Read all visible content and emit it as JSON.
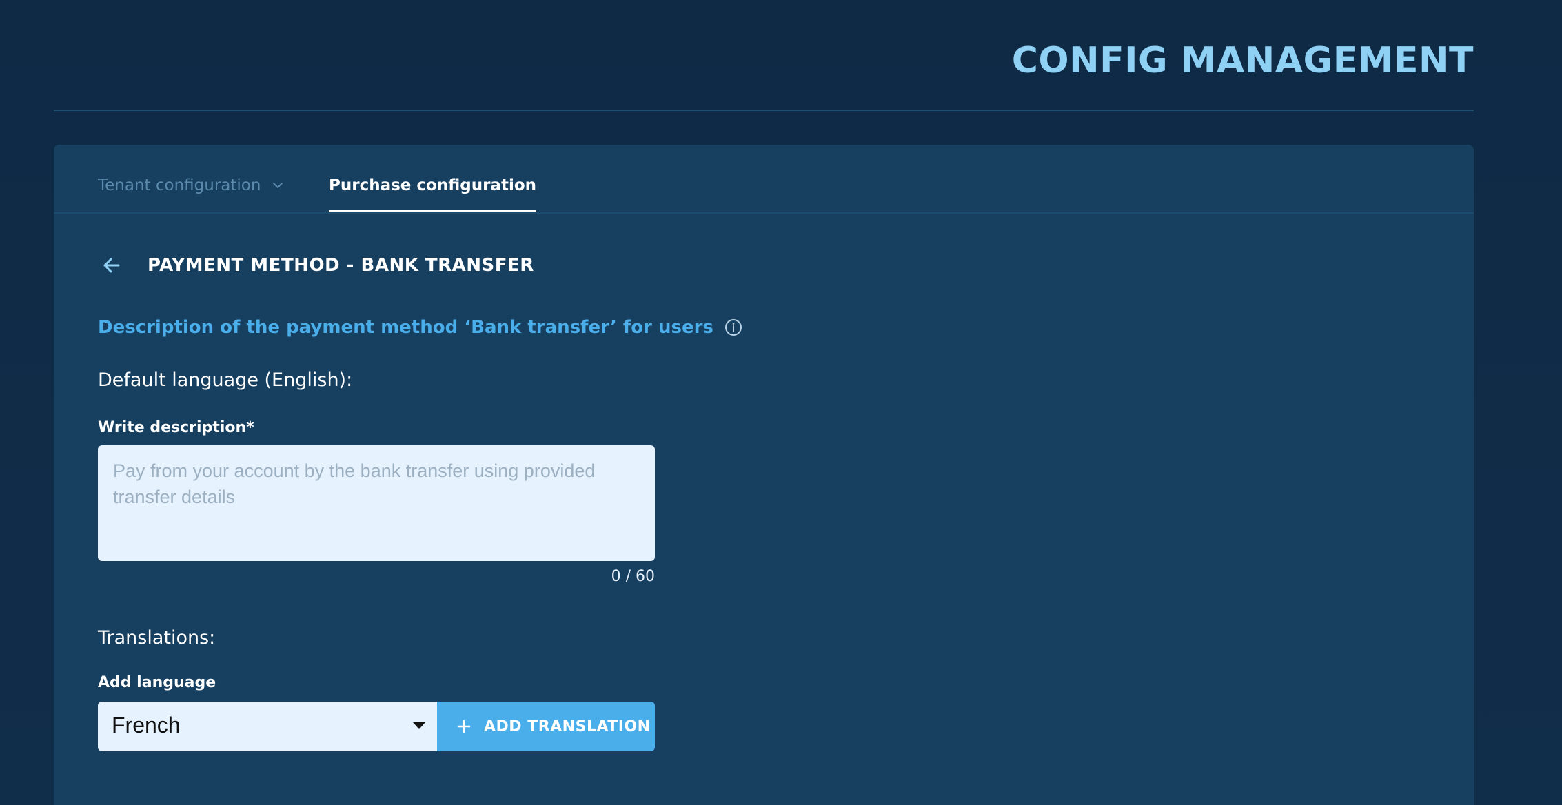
{
  "header": {
    "title": "CONFIG MANAGEMENT"
  },
  "tabs": [
    {
      "label": "Tenant configuration",
      "active": false,
      "icon": "chevron-down-icon"
    },
    {
      "label": "Purchase configuration",
      "active": true
    }
  ],
  "section": {
    "back_icon": "arrow-left-icon",
    "title": "PAYMENT METHOD - BANK TRANSFER"
  },
  "description": {
    "heading": "Description of the payment method ‘Bank transfer’ for users",
    "info_icon": "info-icon",
    "default_language_label": "Default language (English):",
    "field_label": "Write description*",
    "value": "",
    "placeholder": "Pay from your account by the bank transfer using provided transfer details",
    "counter": "0 / 60"
  },
  "translations": {
    "label": "Translations:",
    "add_language_label": "Add language",
    "selected_language": "French",
    "add_button_label": "ADD TRANSLATION",
    "add_button_icon": "plus-icon"
  },
  "colors": {
    "background": "#0f2a45",
    "card": "#163f60",
    "accent": "#4aaeea",
    "title": "#8fd0f5",
    "input_bg": "#e6f2fd"
  }
}
